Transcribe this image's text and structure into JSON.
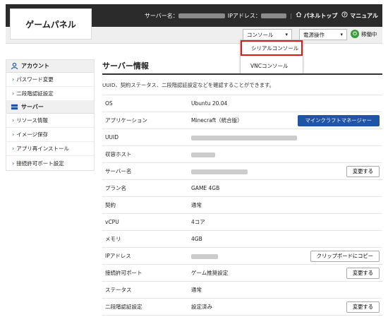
{
  "header": {
    "logo": "ゲームパネル",
    "server_name_label": "サーバー名：",
    "ip_label": "IPアドレス：",
    "panel_top": "パネルトップ",
    "manual": "マニュアル"
  },
  "subbar": {
    "console_select": "コンソール",
    "power_select": "電源操作",
    "status": "稼働中"
  },
  "dropdown": {
    "items": [
      "シリアルコンソール",
      "VNCコンソール"
    ]
  },
  "sidebar": {
    "account_title": "アカウント",
    "account_items": [
      "パスワード変更",
      "二段階認証設定"
    ],
    "server_title": "サーバー",
    "server_items": [
      "リソース情報",
      "イメージ保存",
      "アプリ再インストール",
      "接続許可ポート設定"
    ]
  },
  "main": {
    "title": "サーバー情報",
    "description": "UUID、契約ステータス、二段階認証設定などを確認することができます。",
    "rows": [
      {
        "label": "OS",
        "value": "Ubuntu 20.04"
      },
      {
        "label": "アプリケーション",
        "value": "Minecraft（統合版）",
        "button": "マインクラフトマネージャー"
      },
      {
        "label": "UUID",
        "value": ""
      },
      {
        "label": "収容ホスト",
        "value": ""
      },
      {
        "label": "サーバー名",
        "value": "",
        "button": "変更する"
      },
      {
        "label": "プラン名",
        "value": "GAME 4GB"
      },
      {
        "label": "契約",
        "value": "通常"
      },
      {
        "label": "vCPU",
        "value": "4コア"
      },
      {
        "label": "メモリ",
        "value": "4GB"
      },
      {
        "label": "IPアドレス",
        "value": "",
        "button": "クリップボードにコピー"
      },
      {
        "label": "接続許可ポート",
        "value": "ゲーム推奨設定",
        "button": "変更する"
      },
      {
        "label": "ステータス",
        "value": "通常"
      },
      {
        "label": "二段階認証設定",
        "value": "設定済み",
        "button": "変更する"
      }
    ]
  },
  "colors": {
    "header_bg": "#2b2b2b",
    "primary_button": "#1e55a8",
    "highlight_border": "#e01818",
    "status_green": "#3a9b3a"
  },
  "icons": [
    "home-icon",
    "help-icon",
    "power-icon",
    "user-icon",
    "server-icon"
  ]
}
